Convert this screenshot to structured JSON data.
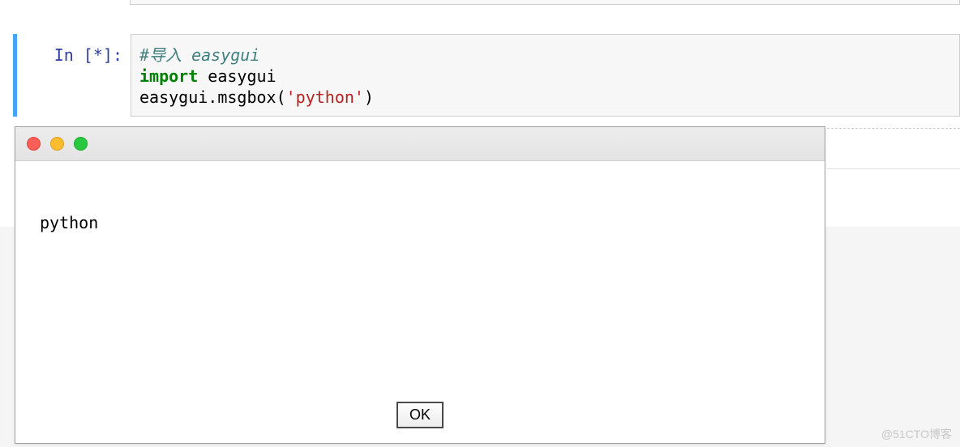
{
  "notebook": {
    "prompt_prefix": "In [",
    "prompt_status": "*",
    "prompt_suffix": "]:",
    "code": {
      "line1_comment": "#导入 easygui",
      "line2_keyword": "import",
      "line2_module": " easygui",
      "line3_call": "easygui.msgbox(",
      "line3_string": "'python'",
      "line3_close": ")"
    }
  },
  "dialog": {
    "message": "python",
    "ok_label": "OK"
  },
  "watermark": "@51CTO博客"
}
